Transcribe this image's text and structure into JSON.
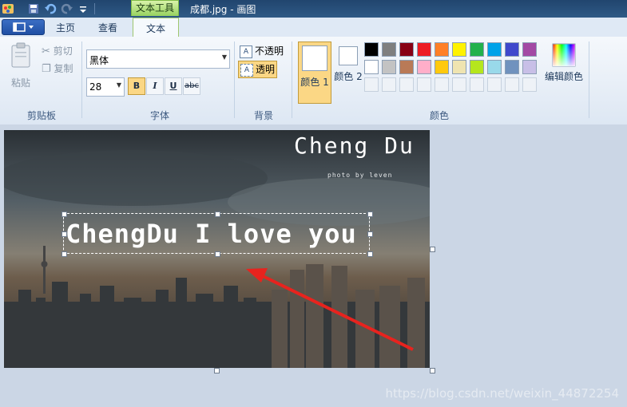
{
  "titlebar": {
    "context_tab": "文本工具",
    "title": "成都.jpg - 画图"
  },
  "tabs": {
    "home": "主页",
    "view": "查看",
    "text": "文本"
  },
  "clipboard": {
    "paste": "粘贴",
    "cut": "剪切",
    "copy": "复制",
    "group_label": "剪贴板"
  },
  "font": {
    "family": "黑体",
    "size": "28",
    "bold": "B",
    "italic": "I",
    "underline": "U",
    "strike": "abc",
    "group_label": "字体"
  },
  "background": {
    "opaque": "不透明",
    "transparent": "透明",
    "group_label": "背景"
  },
  "colors": {
    "color1_label": "颜色 1",
    "color2_label": "颜色 2",
    "edit_colors": "编辑颜色",
    "group_label": "颜色",
    "color1": "#ffffff",
    "color2": "#ffffff",
    "palette_row1": [
      "#000000",
      "#7f7f7f",
      "#880015",
      "#ed1c24",
      "#ff7f27",
      "#fff200",
      "#22b14c",
      "#00a2e8",
      "#3f48cc",
      "#a349a4"
    ],
    "palette_row2": [
      "#ffffff",
      "#c3c3c3",
      "#b97a57",
      "#ffaec9",
      "#ffc90e",
      "#efe4b0",
      "#b5e61d",
      "#99d9ea",
      "#7092be",
      "#c8bfe7"
    ]
  },
  "canvas": {
    "photo_title": "Cheng Du",
    "photo_credit": "photo by leven",
    "typed_text": "ChengDu I love you"
  },
  "watermark": "https://blog.csdn.net/weixin_44872254"
}
